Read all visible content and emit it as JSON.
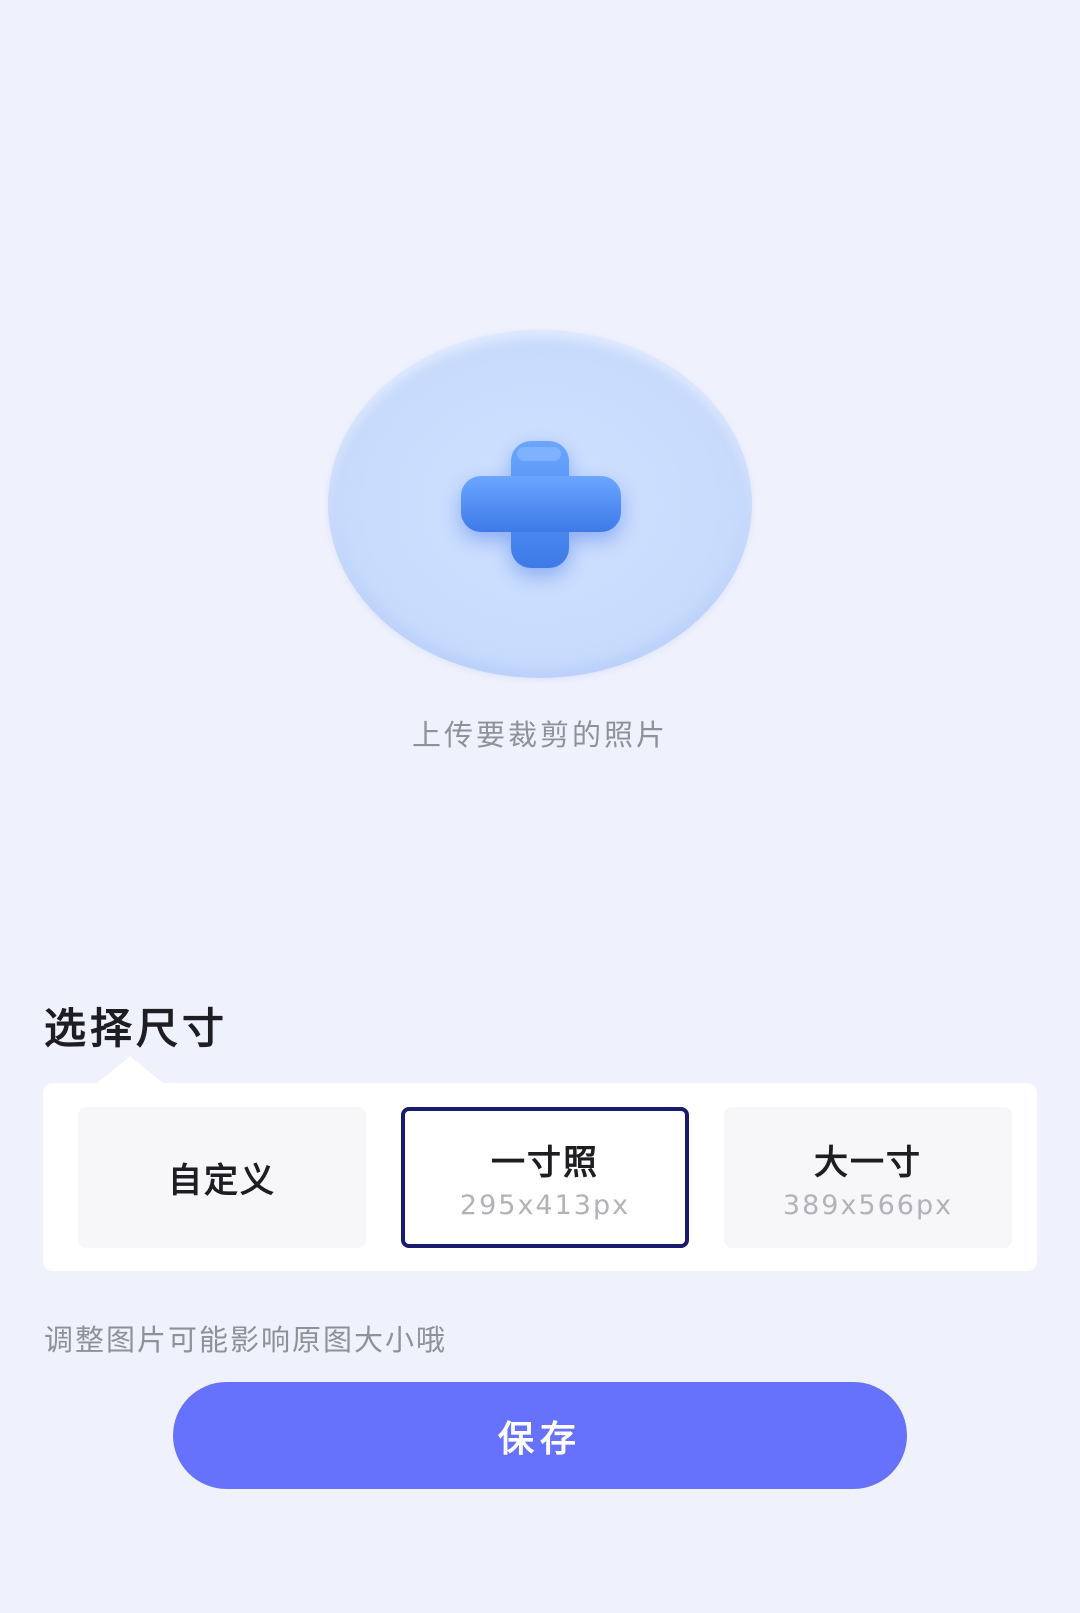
{
  "upload": {
    "caption": "上传要裁剪的照片",
    "icon": "plus-icon"
  },
  "sizes": {
    "title": "选择尺寸",
    "options": [
      {
        "label": "自定义",
        "dims": ""
      },
      {
        "label": "一寸照",
        "dims": "295x413px"
      },
      {
        "label": "大一寸",
        "dims": "389x566px"
      }
    ],
    "selected": "一寸照"
  },
  "hint": "调整图片可能影响原图大小哦",
  "save_label": "保存",
  "colors": {
    "background": "#eff1fd",
    "accent": "#6672fb",
    "plus_icon": "#4a86f0",
    "selected_border": "#1a1a6e"
  }
}
